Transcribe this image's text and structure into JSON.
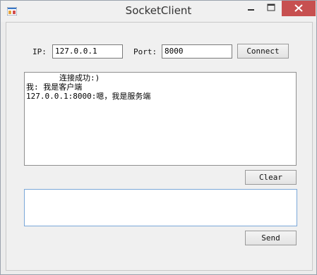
{
  "window": {
    "title": "SocketClient",
    "icon": "app-window-icon",
    "controls": {
      "minimize": "minimize-icon",
      "maximize": "maximize-icon",
      "close": "close-icon"
    },
    "close_color": "#c75050"
  },
  "connection": {
    "ip_label": "IP:",
    "ip_value": "127.0.0.1",
    "port_label": "Port:",
    "port_value": "8000",
    "connect_label": "Connect"
  },
  "log": {
    "lines": [
      "连接成功:)",
      "我: 我是客户端",
      "127.0.0.1:8000:嗯，我是服务端"
    ]
  },
  "actions": {
    "clear_label": "Clear",
    "send_label": "Send",
    "message_input_value": ""
  }
}
